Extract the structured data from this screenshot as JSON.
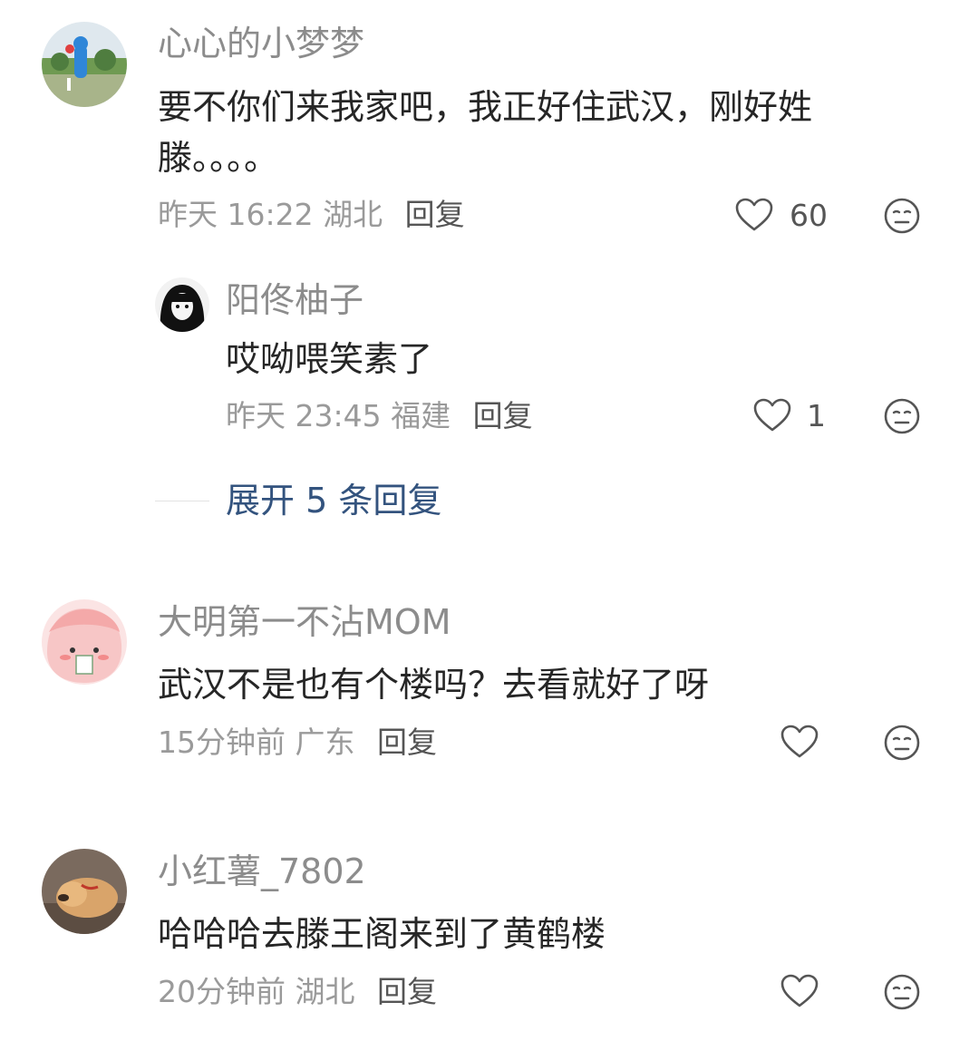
{
  "comments": [
    {
      "username": "心心的小梦梦",
      "text_line1": "要不你们来我家吧，我正好住武汉，刚好姓",
      "text_line2": "滕。。。。",
      "time": "昨天 16:22",
      "location": "湖北",
      "reply_label": "回复",
      "likes": "60",
      "replies": [
        {
          "username": "阳佟柚子",
          "text": "哎呦喂笑素了",
          "time": "昨天 23:45",
          "location": "福建",
          "reply_label": "回复",
          "likes": "1"
        }
      ],
      "expand_label": "展开 5 条回复"
    },
    {
      "username": "大明第一不沾MOM",
      "text": "武汉不是也有个楼吗？去看就好了呀",
      "time": "15分钟前",
      "location": "广东",
      "reply_label": "回复"
    },
    {
      "username": "小红薯_7802",
      "text": "哈哈哈去滕王阁来到了黄鹤楼",
      "time": "20分钟前",
      "location": "湖北",
      "reply_label": "回复"
    }
  ],
  "icons": {
    "like": "heart-outline-icon",
    "emoji": "meh-face-icon"
  },
  "colors": {
    "name": "#8c8c8c",
    "text": "#262626",
    "meta": "#9a9a9a",
    "link": "#33537e"
  }
}
